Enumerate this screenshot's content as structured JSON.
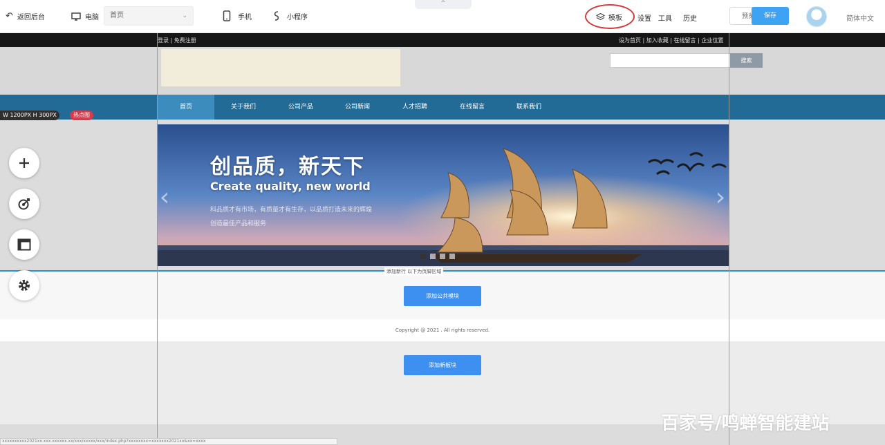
{
  "toolbar": {
    "back_label": "返回后台",
    "desktop_label": "电脑",
    "page_select_value": "首页",
    "mobile_label": "手机",
    "miniapp_label": "小程序",
    "layers_label": "模板",
    "settings_label": "设置",
    "tools_label": "工具",
    "history_label": "历史",
    "preview_label": "预览",
    "save_label": "保存",
    "language_label": "简体中文",
    "collapse_glyph": "^"
  },
  "site": {
    "topbar_login": "登录 | 免费注册",
    "topbar_links": "设为首页 | 加入收藏 | 在线留言 | 企业位置",
    "search_placeholder": "",
    "search_button": "搜索",
    "nav": [
      "首页",
      "关于我们",
      "公司产品",
      "公司新闻",
      "人才招聘",
      "在线留言",
      "联系我们"
    ],
    "size_tag": "W 1200PX H 300PX",
    "hot_tag": "热点图"
  },
  "banner": {
    "title": "创品质，新天下",
    "subtitle": "Create quality, new world",
    "desc_line1": "科品质才有市场，有质量才有生存，以品质打造未来的辉煌",
    "desc_line2": "创造最佳产品和服务",
    "prev": "‹",
    "next": "›",
    "slide_count": 4,
    "active_slide": 1
  },
  "sections": {
    "selection_label": "添加新行  以下为页脚区域",
    "add_module_button": "添加公共模块",
    "copyright": "Copyright @ 2021 . All rights reserved.",
    "add_row_button": "添加新板块"
  },
  "left_tools": [
    "plus-icon",
    "target-icon",
    "layout-icon",
    "gear-icon"
  ],
  "watermark": "百家号/鸣蝉智能建站",
  "status_url": "xxxxxxxxxx2021xx.xxx.xxxxxx.xx/xxx/xxxxx/xxx/index.php?xxxxxxxx=xxxxxxx2021xx&xx=xxxx"
}
